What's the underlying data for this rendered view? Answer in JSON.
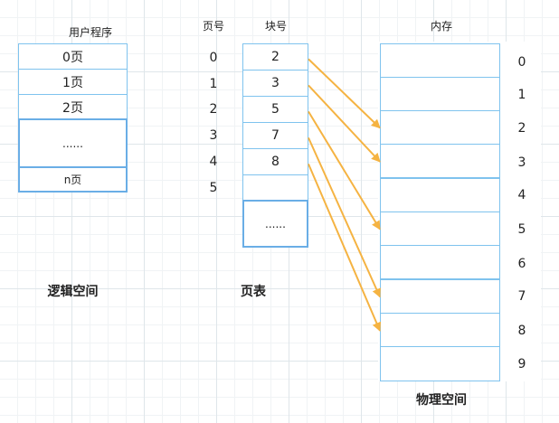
{
  "logical": {
    "header": "用户程序",
    "cells": [
      "0页",
      "1页",
      "2页",
      "......",
      "n页"
    ],
    "caption": "逻辑空间"
  },
  "page_table": {
    "page_header": "页号",
    "block_header": "块号",
    "page_numbers": [
      "0",
      "1",
      "2",
      "3",
      "4",
      "5"
    ],
    "blocks": [
      "2",
      "3",
      "5",
      "7",
      "8",
      "",
      "......"
    ],
    "caption": "页表"
  },
  "memory": {
    "header": "内存",
    "frame_numbers": [
      "0",
      "1",
      "2",
      "3",
      "4",
      "5",
      "6",
      "7",
      "8",
      "9"
    ],
    "caption": "物理空间"
  },
  "mappings": [
    {
      "page": 0,
      "frame": 2
    },
    {
      "page": 1,
      "frame": 3
    },
    {
      "page": 2,
      "frame": 5
    },
    {
      "page": 3,
      "frame": 7
    },
    {
      "page": 4,
      "frame": 8
    }
  ],
  "colors": {
    "cell_border": "#7fc3ee",
    "arrow": "#f5b342"
  }
}
